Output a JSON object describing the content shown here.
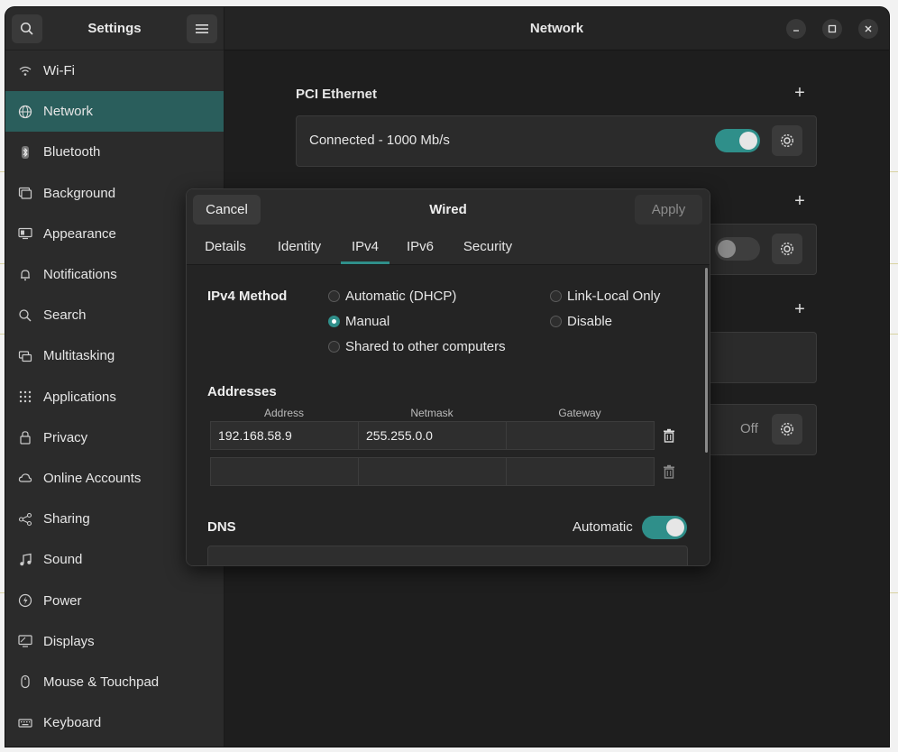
{
  "sidebar": {
    "title": "Settings",
    "items": [
      {
        "label": "Wi-Fi",
        "icon": "wifi-icon"
      },
      {
        "label": "Network",
        "icon": "globe-icon"
      },
      {
        "label": "Bluetooth",
        "icon": "bluetooth-icon"
      },
      {
        "label": "Background",
        "icon": "background-icon"
      },
      {
        "label": "Appearance",
        "icon": "appearance-icon"
      },
      {
        "label": "Notifications",
        "icon": "bell-icon"
      },
      {
        "label": "Search",
        "icon": "search-icon"
      },
      {
        "label": "Multitasking",
        "icon": "multitasking-icon"
      },
      {
        "label": "Applications",
        "icon": "grid-icon"
      },
      {
        "label": "Privacy",
        "icon": "lock-icon"
      },
      {
        "label": "Online Accounts",
        "icon": "cloud-icon"
      },
      {
        "label": "Sharing",
        "icon": "share-icon"
      },
      {
        "label": "Sound",
        "icon": "music-note-icon"
      },
      {
        "label": "Power",
        "icon": "power-icon"
      },
      {
        "label": "Displays",
        "icon": "display-icon"
      },
      {
        "label": "Mouse & Touchpad",
        "icon": "mouse-icon"
      },
      {
        "label": "Keyboard",
        "icon": "keyboard-icon"
      }
    ],
    "active_index": 1
  },
  "main": {
    "title": "Network",
    "pci_ethernet": {
      "title": "PCI Ethernet",
      "status": "Connected - 1000 Mb/s",
      "toggle_on": true
    },
    "proxy_status": "Off"
  },
  "dialog": {
    "title": "Wired",
    "cancel_label": "Cancel",
    "apply_label": "Apply",
    "tabs": [
      "Details",
      "Identity",
      "IPv4",
      "IPv6",
      "Security"
    ],
    "active_tab": "IPv4",
    "ipv4_method_label": "IPv4 Method",
    "methods": {
      "automatic": "Automatic (DHCP)",
      "link_local": "Link-Local Only",
      "manual": "Manual",
      "disable": "Disable",
      "shared": "Shared to other computers"
    },
    "selected_method": "Manual",
    "addresses_label": "Addresses",
    "columns": {
      "address": "Address",
      "netmask": "Netmask",
      "gateway": "Gateway"
    },
    "rows": [
      {
        "address": "192.168.58.9",
        "netmask": "255.255.0.0",
        "gateway": ""
      },
      {
        "address": "",
        "netmask": "",
        "gateway": ""
      }
    ],
    "dns_label": "DNS",
    "dns_automatic_label": "Automatic",
    "dns_automatic_on": true
  },
  "colors": {
    "accent": "#2f8f8a",
    "sidebar_active": "#2a5e5c",
    "window_bg": "#1e1e1e"
  }
}
